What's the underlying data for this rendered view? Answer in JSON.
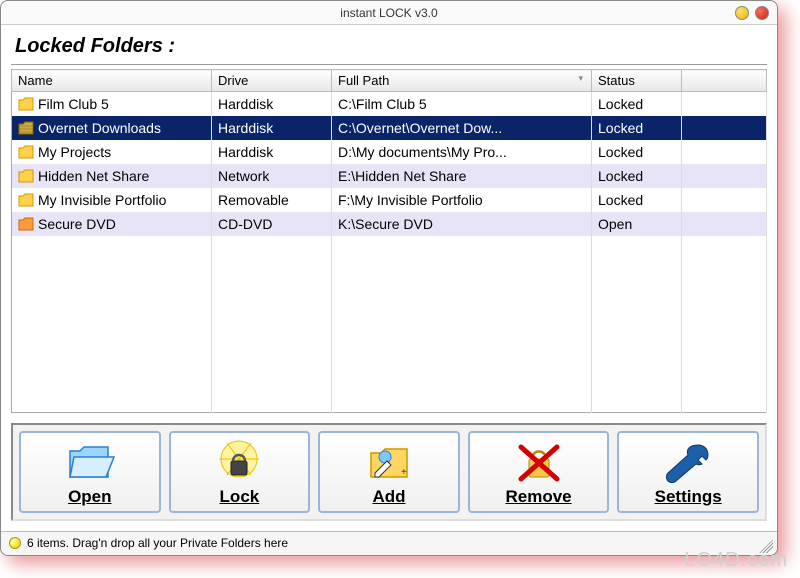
{
  "title": "instant LOCK v3.0",
  "section_title": "Locked Folders :",
  "columns": {
    "name": "Name",
    "drive": "Drive",
    "path": "Full Path",
    "status": "Status"
  },
  "rows": [
    {
      "name": "Film Club 5",
      "drive": "Harddisk",
      "path": "C:\\Film Club 5",
      "status": "Locked",
      "icon": "folder-yellow"
    },
    {
      "name": "Overnet Downloads",
      "drive": "Harddisk",
      "path": "C:\\Overnet\\Overnet Dow...",
      "status": "Locked",
      "icon": "folder-pattern",
      "selected": true
    },
    {
      "name": "My Projects",
      "drive": "Harddisk",
      "path": "D:\\My documents\\My Pro...",
      "status": "Locked",
      "icon": "folder-yellow"
    },
    {
      "name": "Hidden Net Share",
      "drive": "Network",
      "path": "E:\\Hidden Net Share",
      "status": "Locked",
      "icon": "folder-yellow",
      "alt": true
    },
    {
      "name": "My Invisible Portfolio",
      "drive": "Removable",
      "path": "F:\\My Invisible Portfolio",
      "status": "Locked",
      "icon": "folder-yellow"
    },
    {
      "name": "Secure DVD",
      "drive": "CD-DVD",
      "path": "K:\\Secure DVD",
      "status": "Open",
      "icon": "folder-orange",
      "alt": true
    }
  ],
  "blank_rows": 8,
  "toolbar": {
    "open": "Open",
    "lock": "Lock",
    "add": "Add",
    "remove": "Remove",
    "settings": "Settings"
  },
  "status": "6 items. Drag'n drop all your Private Folders here",
  "watermark": "LO4D.com"
}
